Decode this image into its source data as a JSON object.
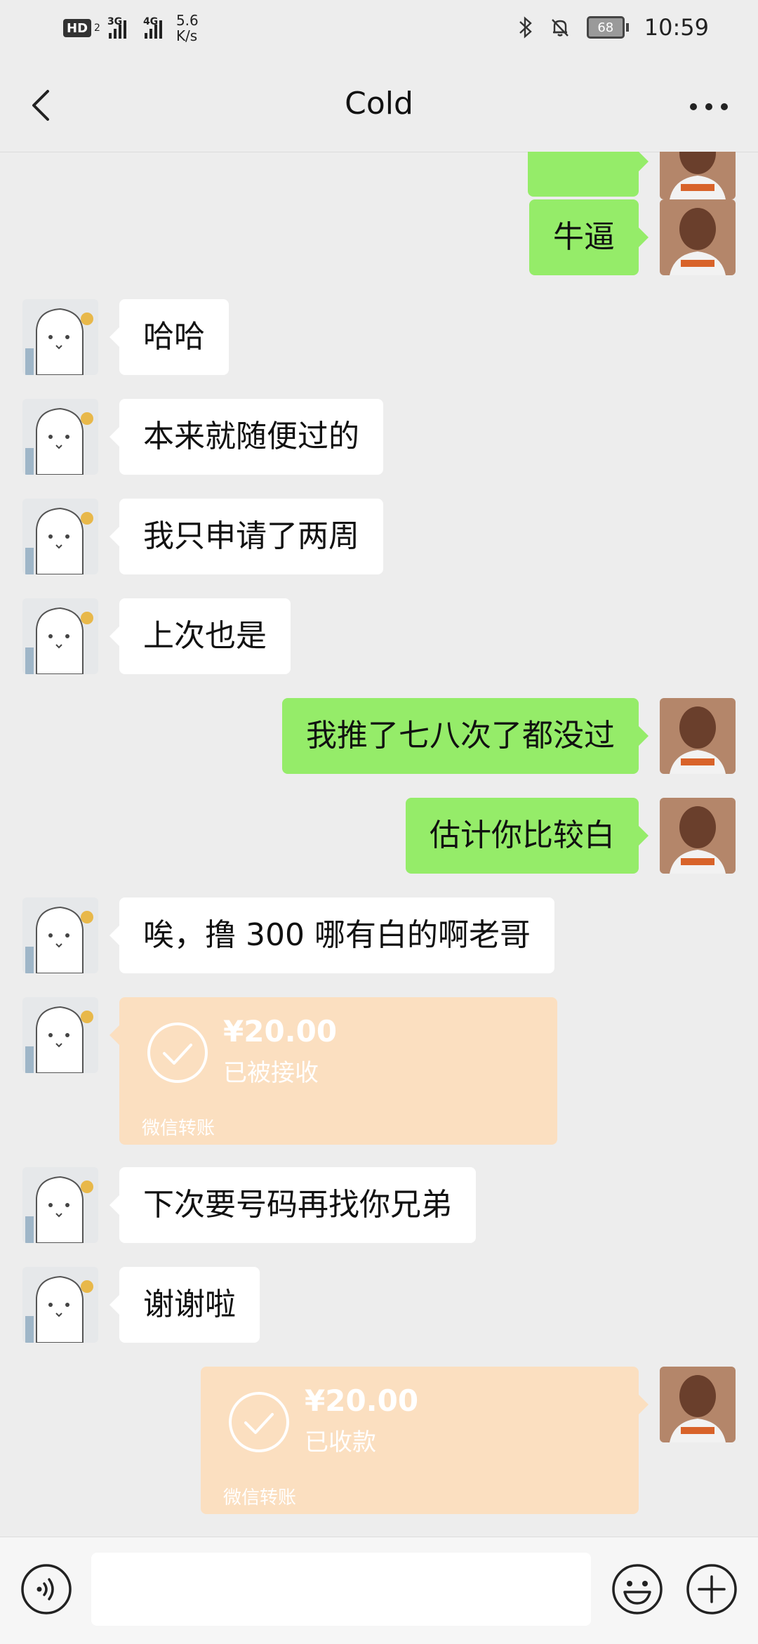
{
  "status_bar": {
    "hd_label": "HD",
    "sim_number": "2",
    "network_1": "3G",
    "network_2": "4G",
    "speed_value": "5.6",
    "speed_unit": "K/s",
    "battery": "68",
    "time": "10:59"
  },
  "header": {
    "title": "Cold"
  },
  "messages": [
    {
      "side": "right",
      "type": "text",
      "text": "牛逼"
    },
    {
      "side": "left",
      "type": "text",
      "text": "哈哈"
    },
    {
      "side": "left",
      "type": "text",
      "text": "本来就随便过的"
    },
    {
      "side": "left",
      "type": "text",
      "text": "我只申请了两周"
    },
    {
      "side": "left",
      "type": "text",
      "text": "上次也是"
    },
    {
      "side": "right",
      "type": "text",
      "text": "我推了七八次了都没过"
    },
    {
      "side": "right",
      "type": "text",
      "text": "估计你比较白"
    },
    {
      "side": "left",
      "type": "text",
      "text": "唉，撸 300 哪有白的啊老哥"
    },
    {
      "side": "left",
      "type": "transfer",
      "amount": "¥20.00",
      "status": "已被接收",
      "source": "微信转账"
    },
    {
      "side": "left",
      "type": "text",
      "text": "下次要号码再找你兄弟"
    },
    {
      "side": "left",
      "type": "text",
      "text": "谢谢啦"
    },
    {
      "side": "right",
      "type": "transfer",
      "amount": "¥20.00",
      "status": "已收款",
      "source": "微信转账"
    }
  ],
  "input_bar": {
    "text_value": ""
  },
  "colors": {
    "background": "#ededed",
    "bubble_sent": "#95ec69",
    "bubble_received": "#ffffff",
    "transfer_card": "#fbdfc0"
  },
  "icons": [
    "back-arrow-icon",
    "more-icon",
    "voice-icon",
    "emoji-icon",
    "plus-icon",
    "check-circle-icon",
    "bluetooth-icon",
    "mute-icon"
  ]
}
